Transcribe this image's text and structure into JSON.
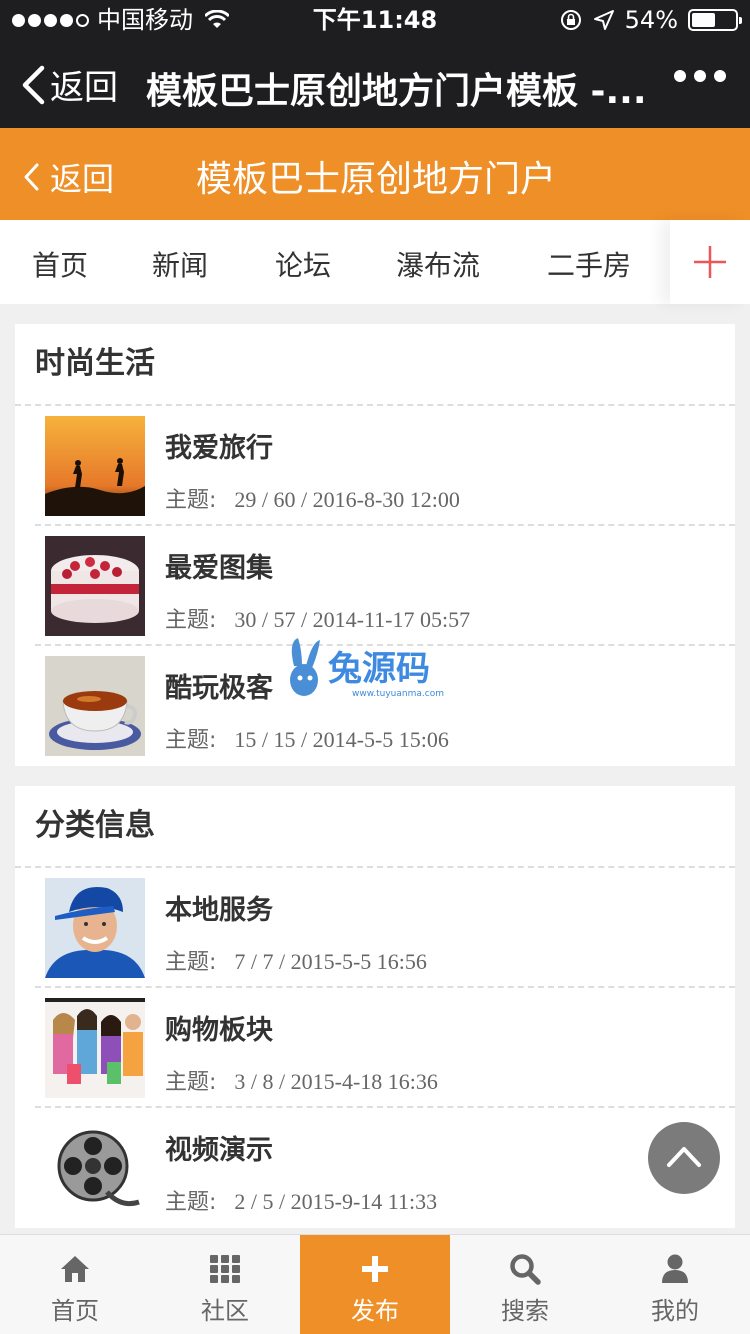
{
  "status_bar": {
    "carrier": "中国移动",
    "time": "下午11:48",
    "battery": "54%",
    "battery_level": 0.54
  },
  "nav": {
    "back_label": "返回",
    "title": "模板巴士原创地方门户模板 -..."
  },
  "header": {
    "back_label": "返回",
    "title": "模板巴士原创地方门户"
  },
  "tabs": [
    "首页",
    "新闻",
    "论坛",
    "瀑布流",
    "二手房"
  ],
  "sections": [
    {
      "title": "时尚生活",
      "items": [
        {
          "name": "我爱旅行",
          "meta_label": "主题:",
          "meta_value": "29 / 60 / 2016-8-30 12:00"
        },
        {
          "name": "最爱图集",
          "meta_label": "主题:",
          "meta_value": "30 / 57 / 2014-11-17 05:57"
        },
        {
          "name": "酷玩极客",
          "meta_label": "主题:",
          "meta_value": "15 / 15 / 2014-5-5 15:06"
        }
      ]
    },
    {
      "title": "分类信息",
      "items": [
        {
          "name": "本地服务",
          "meta_label": "主题:",
          "meta_value": "7 / 7 / 2015-5-5 16:56"
        },
        {
          "name": "购物板块",
          "meta_label": "主题:",
          "meta_value": "3 / 8 / 2015-4-18 16:36"
        },
        {
          "name": "视频演示",
          "meta_label": "主题:",
          "meta_value": "2 / 5 / 2015-9-14 11:33"
        }
      ]
    }
  ],
  "watermark": {
    "text": "兔源码",
    "url": "www.tuyuanma.com"
  },
  "bottom_tabs": [
    {
      "label": "首页",
      "icon": "home-icon"
    },
    {
      "label": "社区",
      "icon": "grid-icon"
    },
    {
      "label": "发布",
      "icon": "plus-icon"
    },
    {
      "label": "搜索",
      "icon": "search-icon"
    },
    {
      "label": "我的",
      "icon": "user-icon"
    }
  ],
  "colors": {
    "accent": "#ef8f27",
    "topbar": "#1e1e20"
  }
}
